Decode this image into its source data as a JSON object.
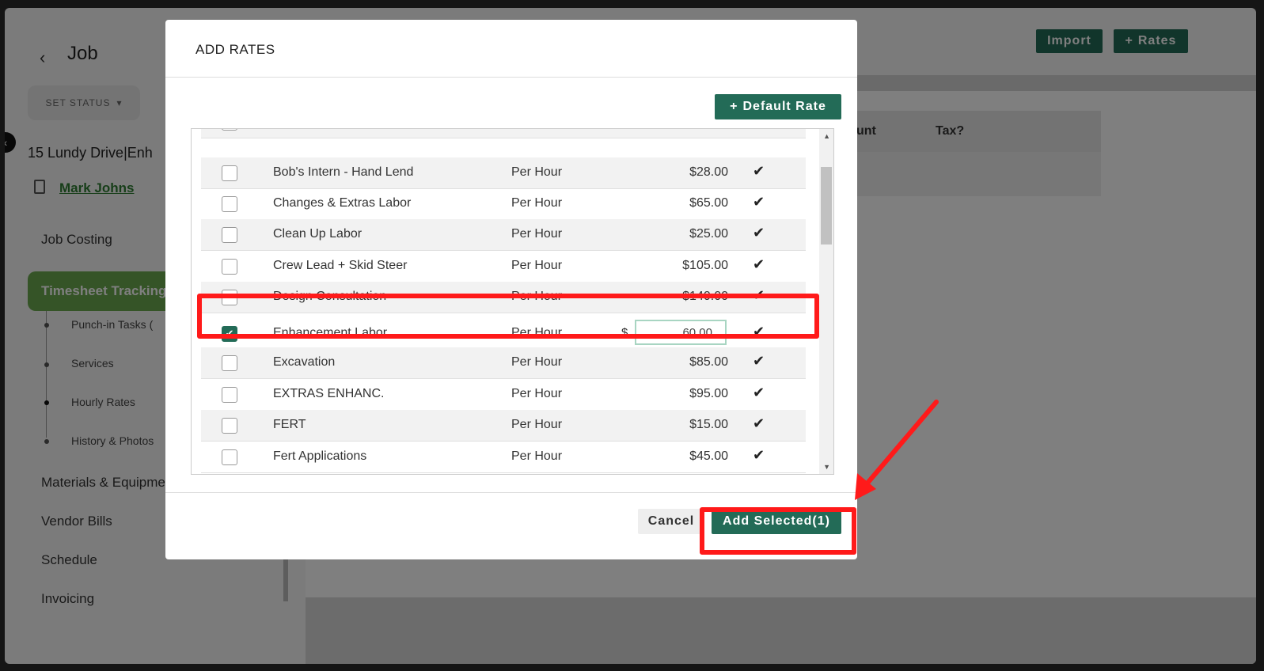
{
  "page": {
    "title": "Job",
    "set_status": "SET STATUS",
    "job_address": "15 Lundy Drive|Enh",
    "contact": "Mark Johns"
  },
  "nav": {
    "job_costing": "Job Costing",
    "timesheet": "Timesheet Tracking",
    "sub": [
      "Punch-in Tasks (",
      "Services",
      "Hourly Rates",
      "History & Photos"
    ],
    "materials": "Materials & Equipme",
    "vendor_bills": "Vendor Bills",
    "schedule": "Schedule",
    "invoicing": "Invoicing"
  },
  "header_buttons": {
    "import": "Import",
    "rates": "Rates"
  },
  "background_table": {
    "amount": "mount",
    "tax": "Tax?"
  },
  "modal": {
    "title": "ADD RATES",
    "default_rate": "Default Rate",
    "cancel": "Cancel",
    "add_selected": "Add Selected(1)",
    "currency": "$",
    "rows": [
      {
        "name": "Bob's Intern - Hand Lend",
        "unit": "Per Hour",
        "price": "$28.00",
        "checked": false
      },
      {
        "name": "Changes & Extras Labor",
        "unit": "Per Hour",
        "price": "$65.00",
        "checked": false
      },
      {
        "name": "Clean Up Labor",
        "unit": "Per Hour",
        "price": "$25.00",
        "checked": false
      },
      {
        "name": "Crew Lead + Skid Steer",
        "unit": "Per Hour",
        "price": "$105.00",
        "checked": false
      },
      {
        "name": "Design Consultation",
        "unit": "Per Hour",
        "price": "$140.00",
        "checked": false
      },
      {
        "name": "Enhancement Labor",
        "unit": "Per Hour",
        "price_input": "60.00",
        "checked": true
      },
      {
        "name": "Excavation",
        "unit": "Per Hour",
        "price": "$85.00",
        "checked": false
      },
      {
        "name": "EXTRAS ENHANC.",
        "unit": "Per Hour",
        "price": "$95.00",
        "checked": false
      },
      {
        "name": "FERT",
        "unit": "Per Hour",
        "price": "$15.00",
        "checked": false
      },
      {
        "name": "Fert Applications",
        "unit": "Per Hour",
        "price": "$45.00",
        "checked": false
      }
    ]
  },
  "icons": {
    "check": "✔",
    "plus": "+",
    "back": "‹",
    "caret": "▾"
  },
  "colors": {
    "primary": "#236b57",
    "nav_active": "#6aa84f",
    "annotation": "#ff1a1a"
  }
}
